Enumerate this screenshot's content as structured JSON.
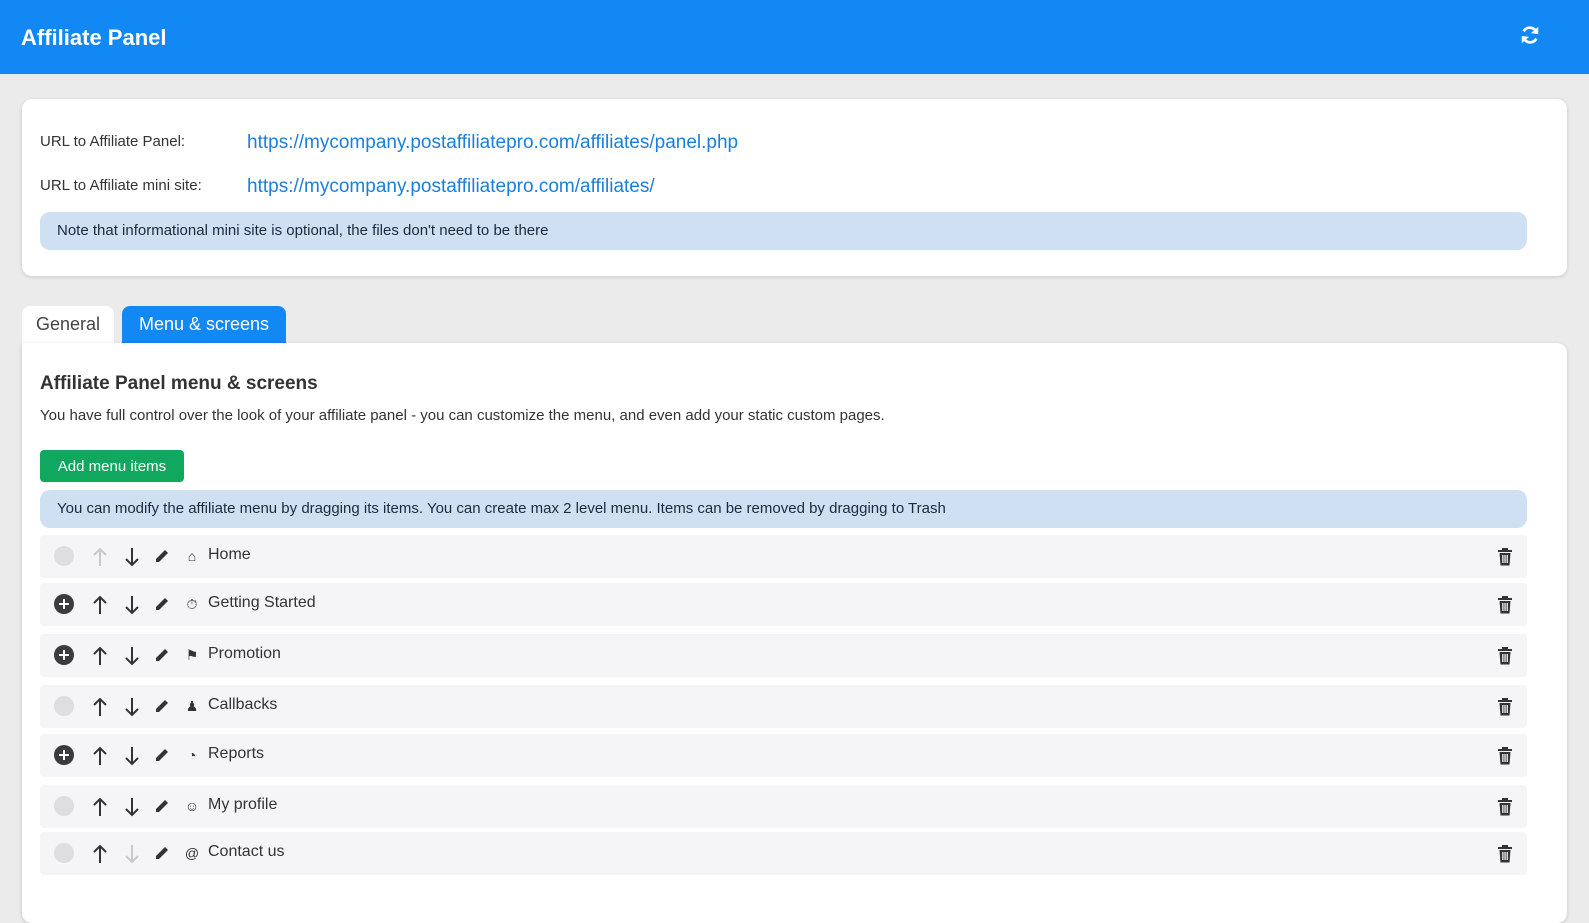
{
  "header": {
    "title": "Affiliate Panel",
    "refresh_icon": "refresh-icon",
    "background": "#1288f5"
  },
  "urls": {
    "panel_label": "URL to Affiliate Panel:",
    "panel_url": "https://mycompany.postaffiliatepro.com/affiliates/panel.php",
    "mini_label": "URL to Affiliate mini site:",
    "mini_url": "https://mycompany.postaffiliatepro.com/affiliates/",
    "note": "Note that informational mini site is optional, the files don't need to be there"
  },
  "tabs": [
    {
      "label": "General",
      "active": false
    },
    {
      "label": "Menu & screens",
      "active": true
    }
  ],
  "menu_section": {
    "title": "Affiliate Panel menu & screens",
    "description": "You have full control over the look of your affiliate panel - you can customize the menu, and even add your static custom pages.",
    "add_button": "Add menu items",
    "info": "You can modify the affiliate menu by dragging its items. You can create max 2 level menu. Items can be removed by dragging to Trash",
    "accent_color": "#10a85f"
  },
  "menu_items": [
    {
      "label": "Home",
      "icon": "home-icon",
      "glyph": "⌂",
      "expandable": false,
      "up_enabled": false,
      "down_enabled": true
    },
    {
      "label": "Getting Started",
      "icon": "stopwatch-icon",
      "glyph": "⏱",
      "expandable": true,
      "up_enabled": true,
      "down_enabled": true
    },
    {
      "label": "Promotion",
      "icon": "bullhorn-icon",
      "glyph": "⚑",
      "expandable": true,
      "up_enabled": true,
      "down_enabled": true
    },
    {
      "label": "Callbacks",
      "icon": "users-icon",
      "glyph": "♟",
      "expandable": false,
      "up_enabled": true,
      "down_enabled": true
    },
    {
      "label": "Reports",
      "icon": "pie-chart-icon",
      "glyph": "◔",
      "expandable": true,
      "up_enabled": true,
      "down_enabled": true
    },
    {
      "label": "My profile",
      "icon": "user-icon",
      "glyph": "☺",
      "expandable": false,
      "up_enabled": true,
      "down_enabled": true
    },
    {
      "label": "Contact us",
      "icon": "at-icon",
      "glyph": "@",
      "expandable": false,
      "up_enabled": true,
      "down_enabled": false
    }
  ]
}
